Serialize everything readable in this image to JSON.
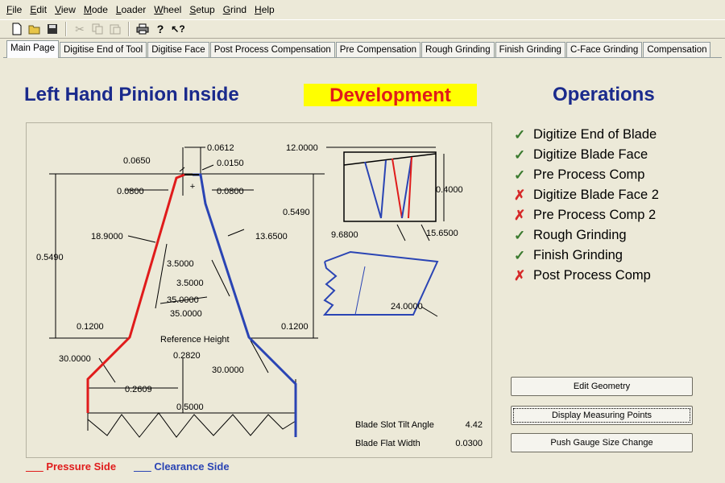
{
  "menu": [
    "File",
    "Edit",
    "View",
    "Mode",
    "Loader",
    "Wheel",
    "Setup",
    "Grind",
    "Help"
  ],
  "menu_underline": [
    "F",
    "E",
    "V",
    "M",
    "L",
    "W",
    "S",
    "G",
    "H"
  ],
  "toolbar": {
    "icons": [
      "new-file-icon",
      "open-folder-icon",
      "save-icon",
      "cut-icon",
      "copy-icon",
      "paste-icon",
      "print-icon",
      "help-icon",
      "context-help-icon"
    ]
  },
  "tabs": [
    "Main Page",
    "Digitise End of Tool",
    "Digitise Face",
    "Post Process Compensation",
    "Pre Compensation",
    "Rough Grinding",
    "Finish Grinding",
    "C-Face Grinding",
    "Compensation"
  ],
  "header": {
    "title": "Left Hand Pinion Inside",
    "mode": "Development",
    "operations_title": "Operations"
  },
  "drawing": {
    "dims": {
      "d0612": "0.0612",
      "d0650": "0.0650",
      "d0150": "0.0150",
      "d0800a": "0.0800",
      "d0800b": "0.0800",
      "d0549a": "0.5490",
      "d0549b": "0.5490",
      "a18900": "18.9000",
      "a13650": "13.6500",
      "a35000a": "3.5000",
      "a35000b": "3.5000",
      "a350000a": "35.0000",
      "a350000b": "35.0000",
      "d1200a": "0.1200",
      "d1200b": "0.1200",
      "ref_height": "Reference Height",
      "d2820": "0.2820",
      "a30000a": "30.0000",
      "a30000b": "30.0000",
      "d2609": "0.2609",
      "d5000": "0.5000",
      "d12000": "12.0000",
      "d4000": "0.4000",
      "a9680": "9.6800",
      "a15650": "15.6500",
      "a24000": "24.0000"
    },
    "blade_slot_tilt_label": "Blade Slot Tilt Angle",
    "blade_slot_tilt_value": "4.42",
    "blade_flat_width_label": "Blade Flat Width",
    "blade_flat_width_value": "0.0300"
  },
  "operations": [
    {
      "label": "Digitize End of Blade",
      "status": "done"
    },
    {
      "label": "Digitize Blade Face",
      "status": "done"
    },
    {
      "label": "Pre Process Comp",
      "status": "done"
    },
    {
      "label": "Digitize Blade Face 2",
      "status": "failed"
    },
    {
      "label": "Pre Process Comp 2",
      "status": "failed"
    },
    {
      "label": "Rough Grinding",
      "status": "done"
    },
    {
      "label": "Finish Grinding",
      "status": "done"
    },
    {
      "label": "Post Process Comp",
      "status": "failed"
    }
  ],
  "marks": {
    "done": "✓",
    "failed": "✗"
  },
  "buttons": {
    "edit_geometry": "Edit Geometry",
    "display_measuring_points": "Display Measuring Points",
    "push_gauge": "Push Gauge Size Change"
  },
  "legend": {
    "pressure": "Pressure Side",
    "clearance": "Clearance Side",
    "line": "___"
  },
  "colors": {
    "pressure": "#e01b1b",
    "clearance": "#2a44b4",
    "heading": "#1a2a8c",
    "highlight": "#ffff00"
  }
}
